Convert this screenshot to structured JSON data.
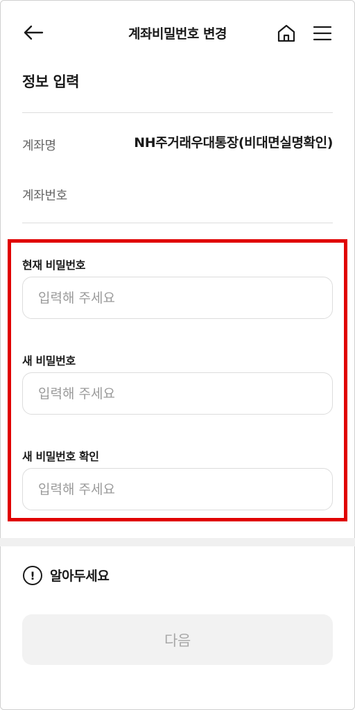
{
  "header": {
    "title": "계좌비밀번호 변경",
    "icons": {
      "back": "arrow-left-icon",
      "home": "home-icon",
      "menu": "hamburger-menu-icon"
    }
  },
  "info_section": {
    "title": "정보 입력",
    "account_name_label": "계좌명",
    "account_name_value": "NH주거래우대통장(비대면실명확인)",
    "account_number_label": "계좌번호",
    "account_number_value": ""
  },
  "form": {
    "current_password": {
      "label": "현재 비밀번호",
      "value": "",
      "placeholder": "입력해 주세요"
    },
    "new_password": {
      "label": "새 비밀번호",
      "value": "",
      "placeholder": "입력해 주세요"
    },
    "confirm_password": {
      "label": "새 비밀번호 확인",
      "value": "",
      "placeholder": "입력해 주세요"
    }
  },
  "notice": {
    "title": "알아두세요",
    "icon": "exclamation-circle-icon"
  },
  "footer": {
    "next_label": "다음"
  },
  "colors": {
    "highlight": "#e00000",
    "disabled_button_bg": "#f2f2f2",
    "disabled_button_text": "#a8a8a8"
  }
}
